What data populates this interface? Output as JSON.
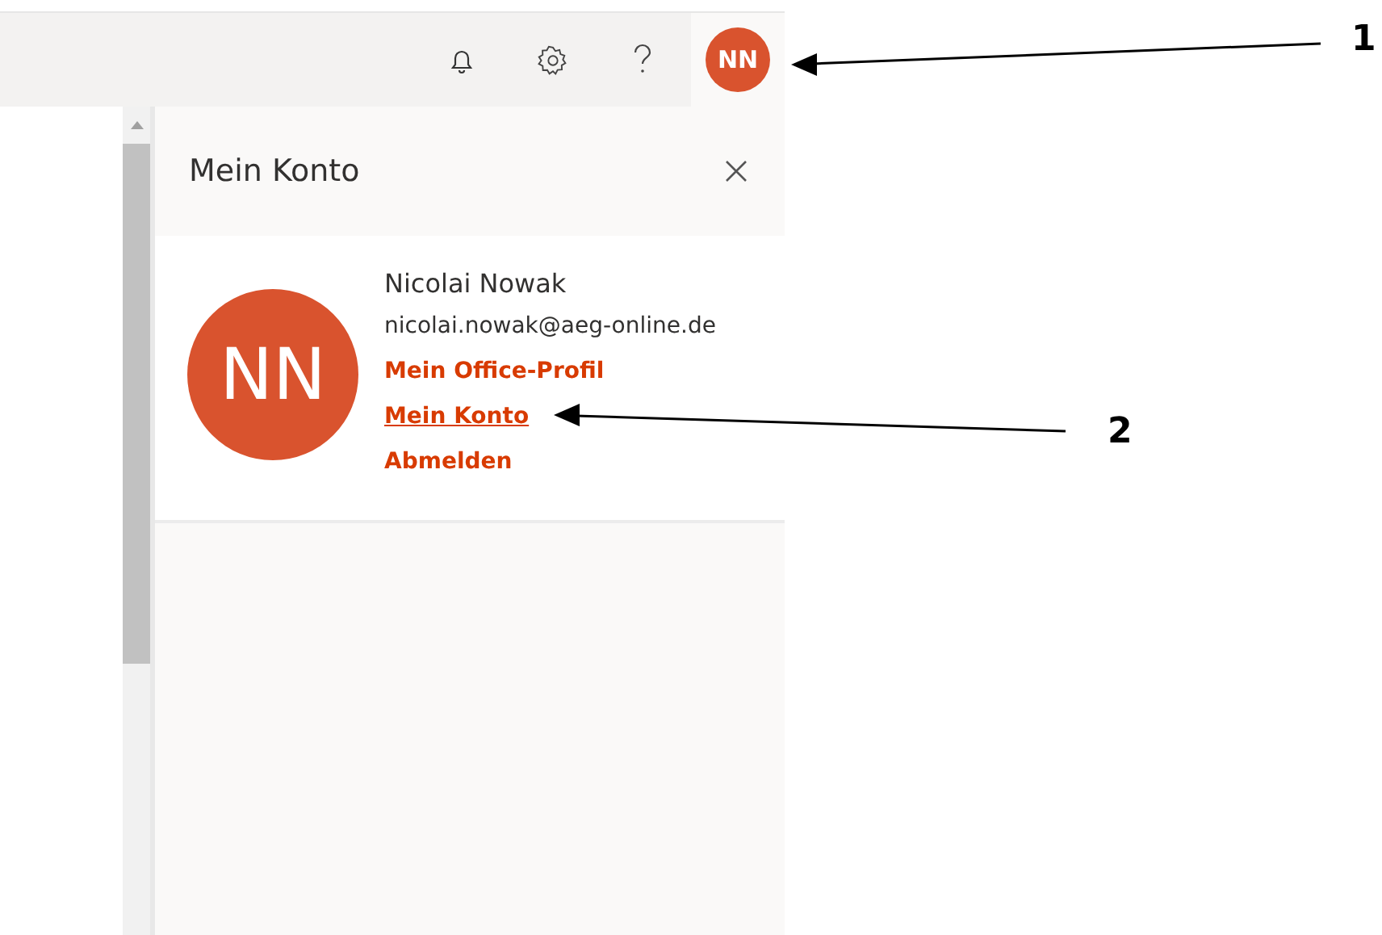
{
  "top_bar": {
    "avatar_initials": "NN"
  },
  "panel": {
    "title": "Mein Konto",
    "account": {
      "initials": "NN",
      "name": "Nicolai Nowak",
      "email": "nicolai.nowak@aeg-online.de",
      "links": [
        {
          "label": "Mein Office-Profil",
          "focused": false
        },
        {
          "label": "Mein Konto",
          "focused": true
        },
        {
          "label": "Abmelden",
          "focused": false
        }
      ]
    }
  },
  "annotations": [
    {
      "label": "1",
      "kind": "upper"
    },
    {
      "label": "2",
      "kind": "lower"
    }
  ]
}
